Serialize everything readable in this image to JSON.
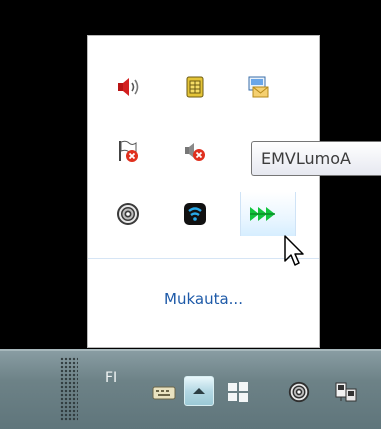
{
  "tray_popup": {
    "icons": [
      {
        "name": "speaker-icon",
        "tooltip": ""
      },
      {
        "name": "sim-card-icon",
        "tooltip": ""
      },
      {
        "name": "envelope-picture-icon",
        "tooltip": ""
      },
      {
        "name": "flag-error-icon",
        "tooltip": ""
      },
      {
        "name": "speaker-muted-icon",
        "tooltip": ""
      },
      {
        "name": "hidden-partial-icon",
        "tooltip": ""
      },
      {
        "name": "spiral-disc-icon",
        "tooltip": ""
      },
      {
        "name": "wifi-app-icon",
        "tooltip": ""
      },
      {
        "name": "green-arrows-icon",
        "tooltip": "EMVLumoA"
      }
    ],
    "customize_label": "Mukauta..."
  },
  "tooltip": {
    "text": "EMVLumoA"
  },
  "taskbar": {
    "language": "FI",
    "icons": [
      "keyboard-icon",
      "show-hidden-icons-arrow",
      "windows-logo-icon",
      "spiral-disc-icon",
      "network-monitor-icon"
    ]
  },
  "colors": {
    "link": "#1e5aa8",
    "taskbar": "#6d8287",
    "popup_bg": "#ffffff"
  }
}
